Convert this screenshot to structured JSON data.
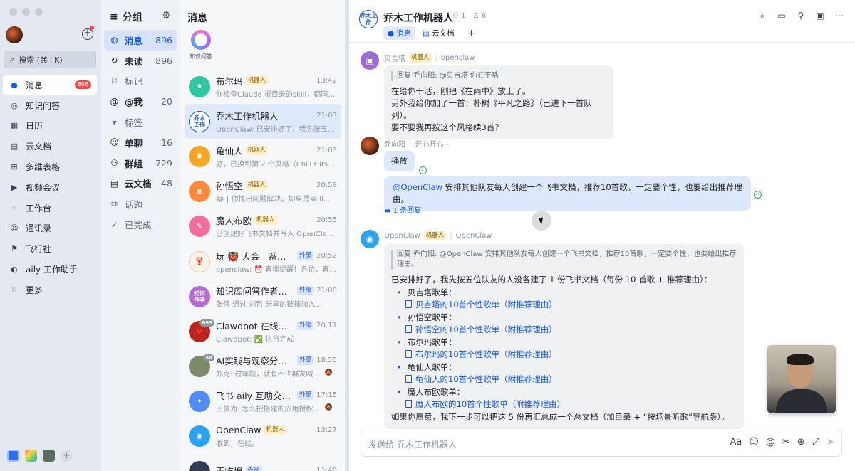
{
  "nav": {
    "search_label": "搜索 (⌘+K)",
    "items": [
      {
        "label": "消息",
        "icon": "chat-bubble-icon",
        "badge": "896"
      },
      {
        "label": "知识问答",
        "icon": "qa-icon"
      },
      {
        "label": "日历",
        "icon": "calendar-icon"
      },
      {
        "label": "云文档",
        "icon": "cloud-doc-icon"
      },
      {
        "label": "多维表格",
        "icon": "bitable-icon"
      },
      {
        "label": "视频会议",
        "icon": "video-icon"
      },
      {
        "label": "工作台",
        "icon": "workplace-icon"
      },
      {
        "label": "通讯录",
        "icon": "contacts-icon"
      },
      {
        "label": "飞行社",
        "icon": "moments-icon"
      },
      {
        "label": "aily 工作助手",
        "icon": "aily-icon"
      },
      {
        "label": "更多",
        "icon": "more-apps-icon"
      }
    ]
  },
  "groups": {
    "title": "分组",
    "items": [
      {
        "label": "消息",
        "count": "896"
      },
      {
        "label": "未读",
        "count": "896"
      },
      {
        "label": "标记",
        "count": ""
      },
      {
        "label": "@我",
        "count": "20"
      },
      {
        "label": "标签",
        "count": ""
      },
      {
        "label": "单聊",
        "count": "16"
      },
      {
        "label": "群组",
        "count": "729"
      },
      {
        "label": "云文档",
        "count": "48"
      },
      {
        "label": "话题",
        "count": ""
      },
      {
        "label": "已完成",
        "count": ""
      }
    ]
  },
  "chatlist": {
    "title": "消息",
    "qa_label": "知识问答",
    "chats": [
      {
        "name": "布尔玛",
        "tag": "机器人",
        "tag_type": "bot",
        "time": "13:42",
        "preview": "你检查Claude 根目录的skill，都同步...",
        "color": "#2ec7a0",
        "avatar_text": "★"
      },
      {
        "name": "乔木工作机器人",
        "tag": "",
        "tag_type": "",
        "time": "21:03",
        "preview": "OpenClaw: 已安排好了，我先按五位...",
        "color": "#ffffff",
        "avatar_text": "乔木工作"
      },
      {
        "name": "龟仙人",
        "tag": "机器人",
        "tag_type": "bot",
        "time": "21:03",
        "preview": "好，已换到第 2 个风格（Chill Hits）...",
        "color": "#f5a623",
        "avatar_text": "◉"
      },
      {
        "name": "孙悟空",
        "tag": "机器人",
        "tag_type": "bot",
        "time": "20:58",
        "preview": "😂 | 你找出问题解决，如果是skill问...",
        "color": "#ff8a3d",
        "avatar_text": "◉"
      },
      {
        "name": "魔人布欧",
        "tag": "机器人",
        "tag_type": "bot",
        "time": "20:55",
        "preview": "已创建好飞书文档并写入 OpenClaw ...",
        "color": "#f26d9b",
        "avatar_text": "✎"
      },
      {
        "name": "玩 👹 大会｜系列直...",
        "tag": "外部",
        "tag_type": "ext",
        "time": "20:52",
        "preview": "openclaw: ⏰ 直播提醒！各位，直播...",
        "color": "#fff4e8",
        "avatar_text": "🦞"
      },
      {
        "name": "知识库问答作者内测",
        "tag": "外部",
        "tag_type": "ext",
        "time": "21:00",
        "preview": "张伟 通过 刘哲 分享的链接加入...",
        "color": "#b56bd6",
        "avatar_text": "知识作者"
      },
      {
        "name": "Clawdbot 在线体验...",
        "tag": "外部",
        "tag_type": "ext",
        "time": "20:11",
        "preview": "ClawdBot: ✅ 执行完成",
        "color": "#b8261e",
        "avatar_text": "🦞",
        "badge": "695"
      },
      {
        "name": "AI实践与观察分享群",
        "tag": "外部",
        "tag_type": "ext",
        "time": "18:55",
        "preview": "郑克: 过年前，就有不少群友喊...",
        "color": "#7c8a6a",
        "avatar_text": "",
        "badge": "58",
        "muted": true
      },
      {
        "name": "飞书 aily 互助交流二...",
        "tag": "外部",
        "tag_type": "ext",
        "time": "17:15",
        "preview": "王俊为: 怎么把搭建的应用授权...",
        "color": "#4f8cf7",
        "avatar_text": "✦",
        "muted": true
      },
      {
        "name": "OpenClaw",
        "tag": "机器人",
        "tag_type": "bot",
        "time": "13:27",
        "preview": "收到，在线。",
        "color": "#2aa3f0",
        "avatar_text": "◉"
      },
      {
        "name": "王屹煌",
        "tag": "外部",
        "tag_type": "ext",
        "time": "11:40",
        "preview": "",
        "color": "#333c55",
        "avatar_text": ""
      }
    ]
  },
  "main": {
    "title": "乔木工作机器人",
    "avatar_text": "乔木工作",
    "member_count": "1",
    "bot_count": "6",
    "tab_messages": "消息",
    "tab_docs": "云文档",
    "composer_placeholder": "发送给 乔木工作机器人",
    "messages": {
      "m1": {
        "sender": "贝吉塔",
        "tag": "机器人",
        "source": "openclaw",
        "quote": "回复 乔向阳: @贝吉塔 你在干啥",
        "lines": [
          "在给你干活，刚把《在雨中》放上了。",
          "另外我给你加了一首：朴树《平凡之路》（已进下一首队列）。",
          "要不要我再按这个风格续3首？"
        ]
      },
      "m2": {
        "sender": "乔向阳",
        "status": "开心开心~",
        "bubble1": "播放",
        "mention": "@OpenClaw",
        "bubble2": "安排其他队友每人创建一个飞书文档，推荐10首歌，一定要个性，也要给出推荐理由。",
        "reply_link": "1 条回复"
      },
      "m3": {
        "sender": "OpenClaw",
        "tag": "机器人",
        "source": "OpenClaw",
        "quote": "回复 乔向阳: @OpenClaw 安排其他队友每人创建一个飞书文档，推荐10首歌，一定要个性，也要给出推荐理由。",
        "intro": "已安排好了，我先按五位队友的人设各建了 1 份飞书文档（每份 10 首歌 + 推荐理由）：",
        "songs": [
          {
            "head": "贝吉塔歌单：",
            "link": "贝吉塔的10首个性歌单（附推荐理由）"
          },
          {
            "head": "孙悟空歌单：",
            "link": "孙悟空的10首个性歌单（附推荐理由）"
          },
          {
            "head": "布尔玛歌单：",
            "link": "布尔玛的10首个性歌单（附推荐理由）"
          },
          {
            "head": "龟仙人歌单：",
            "link": "龟仙人的10首个性歌单（附推荐理由）"
          },
          {
            "head": "魔人布欧歌单：",
            "link": "魔人布欧的10首个性歌单（附推荐理由）"
          }
        ],
        "outro": "如果你愿意，我下一步可以把这 5 份再汇总成一个总文档（加目录 + “按场景听歌”导航版）。"
      }
    }
  },
  "colors": {
    "accent": "#1456f0",
    "badge_red": "#f54a45",
    "bot_tag_bg": "#fdefc6",
    "ext_tag_bg": "#d6e4ff"
  }
}
